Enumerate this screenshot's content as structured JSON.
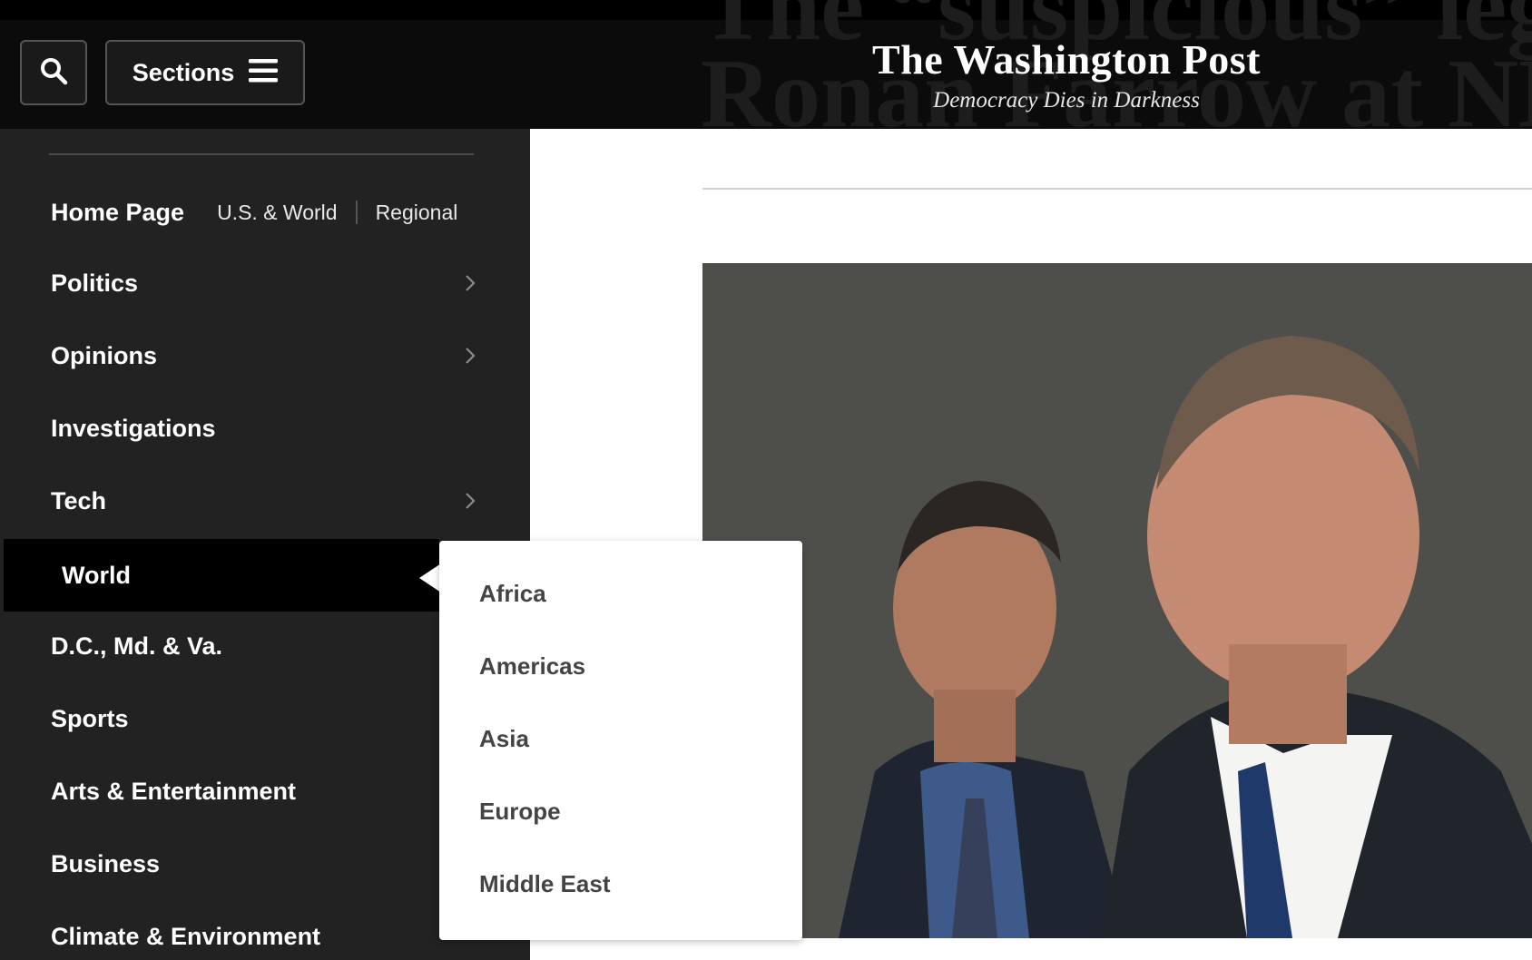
{
  "header": {
    "search_icon": "search-icon",
    "sections_label": "Sections",
    "menu_icon": "hamburger-icon",
    "logo_name": "The Washington Post",
    "logo_tagline": "Democracy Dies in Darkness",
    "background": "#0b0b0b"
  },
  "article": {
    "headline_line1": "The “suspicious” legal w",
    "headline_line2": "Ronan Farrow at NBC"
  },
  "sidebar": {
    "home": {
      "label": "Home Page",
      "links": [
        "U.S. & World",
        "Regional"
      ]
    },
    "items": [
      {
        "label": "Politics",
        "has_submenu": true
      },
      {
        "label": "Opinions",
        "has_submenu": true
      },
      {
        "label": "Investigations",
        "has_submenu": false
      },
      {
        "label": "Tech",
        "has_submenu": true
      },
      {
        "label": "World",
        "has_submenu": true,
        "active": true
      },
      {
        "label": "D.C., Md. & Va.",
        "has_submenu": false
      },
      {
        "label": "Sports",
        "has_submenu": false
      },
      {
        "label": "Arts & Entertainment",
        "has_submenu": false
      },
      {
        "label": "Business",
        "has_submenu": false
      },
      {
        "label": "Climate & Environment",
        "has_submenu": false
      }
    ],
    "background": "#222222",
    "active_background": "#000000"
  },
  "flyout": {
    "items": [
      "Africa",
      "Americas",
      "Asia",
      "Europe",
      "Middle East"
    ],
    "text_color": "#444444"
  }
}
